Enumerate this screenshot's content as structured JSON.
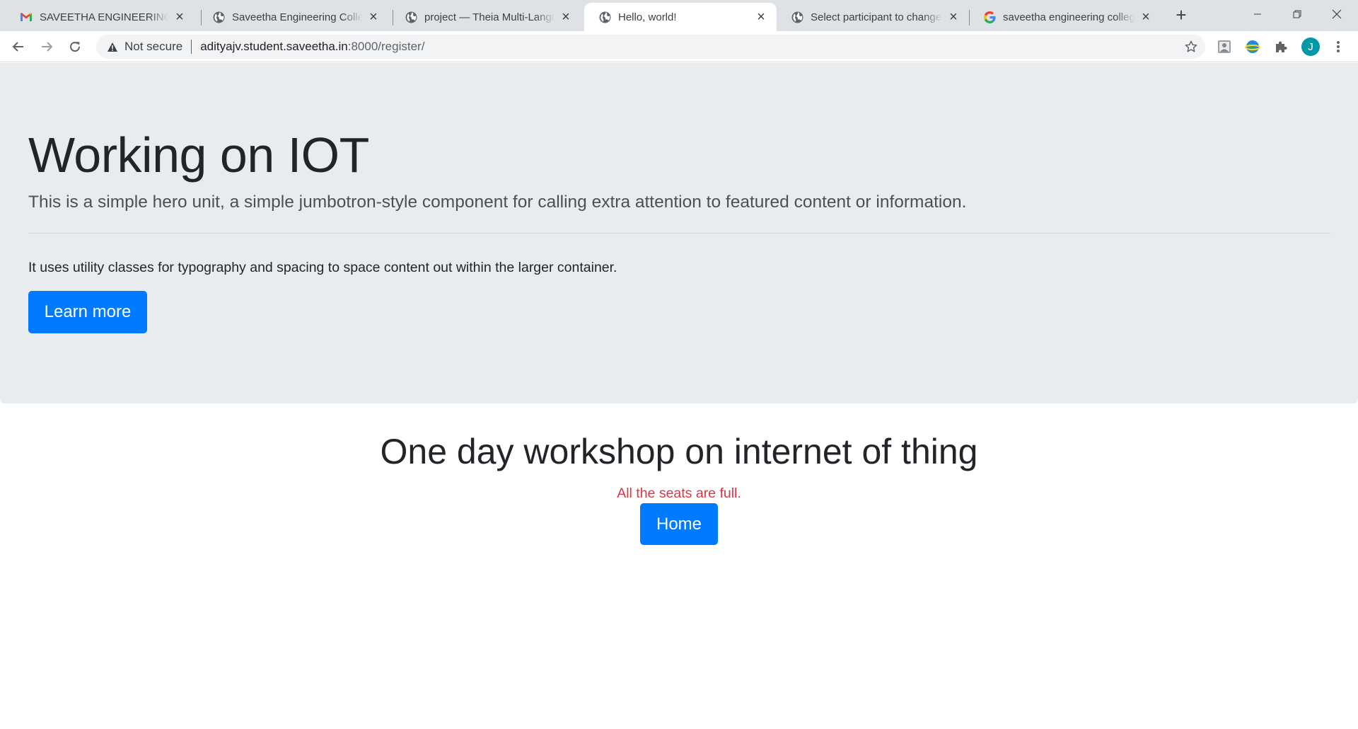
{
  "browser": {
    "tabs": [
      {
        "title": "SAVEETHA ENGINEERING COLLEGE Mail",
        "favicon": "gmail-icon",
        "active": false
      },
      {
        "title": "Saveetha Engineering College",
        "favicon": "globe-icon",
        "active": false
      },
      {
        "title": "project — Theia Multi-Language",
        "favicon": "globe-icon",
        "active": false
      },
      {
        "title": "Hello, world!",
        "favicon": "globe-icon",
        "active": true
      },
      {
        "title": "Select participant to change | Django",
        "favicon": "globe-icon",
        "active": false
      },
      {
        "title": "saveetha engineering college - Google",
        "favicon": "google-icon",
        "active": false
      }
    ],
    "security_label": "Not secure",
    "url_host": "adityajv.student.saveetha.in",
    "url_path": ":8000/register/",
    "profile_initial": "J"
  },
  "page": {
    "hero": {
      "heading": "Working on IOT",
      "lead": "This is a simple hero unit, a simple jumbotron-style component for calling extra attention to featured content or information.",
      "body": "It uses utility classes for typography and spacing to space content out within the larger container.",
      "button_label": "Learn more"
    },
    "workshop": {
      "title": "One day workshop on internet of thing",
      "status_message": "All the seats are full.",
      "home_button_label": "Home"
    }
  },
  "colors": {
    "primary": "#007bff",
    "danger": "#dc3545",
    "jumbotron_bg": "#e9ecef",
    "profile_avatar": "#0097a7"
  }
}
